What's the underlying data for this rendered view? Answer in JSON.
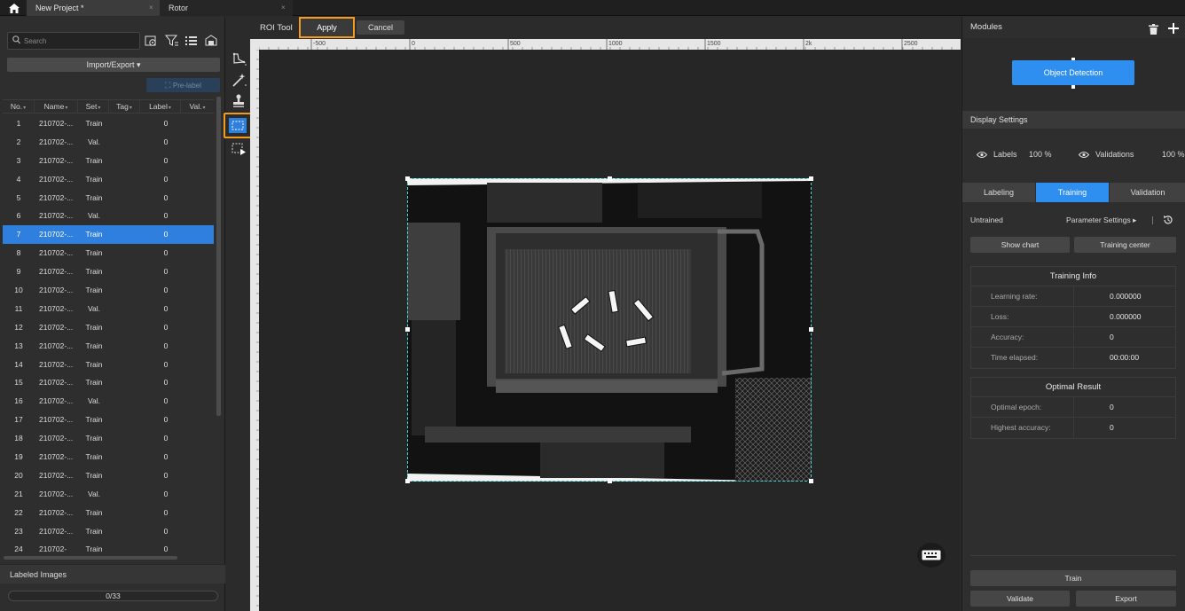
{
  "tabs": {
    "project": "New Project *",
    "rotor": "Rotor",
    "close_glyph": "×"
  },
  "left": {
    "search_placeholder": "Search",
    "import_export": "Import/Export ▾",
    "prelabel": "Pre-label",
    "columns": {
      "no": "No.",
      "name": "Name",
      "set": "Set",
      "tag": "Tag",
      "label": "Label",
      "val": "Val."
    },
    "rows": [
      {
        "no": "1",
        "name": "210702-...",
        "set": "Train",
        "label": "0"
      },
      {
        "no": "2",
        "name": "210702-...",
        "set": "Val.",
        "label": "0"
      },
      {
        "no": "3",
        "name": "210702-...",
        "set": "Train",
        "label": "0"
      },
      {
        "no": "4",
        "name": "210702-...",
        "set": "Train",
        "label": "0"
      },
      {
        "no": "5",
        "name": "210702-...",
        "set": "Train",
        "label": "0"
      },
      {
        "no": "6",
        "name": "210702-...",
        "set": "Val.",
        "label": "0"
      },
      {
        "no": "7",
        "name": "210702-...",
        "set": "Train",
        "label": "0",
        "selected": true
      },
      {
        "no": "8",
        "name": "210702-...",
        "set": "Train",
        "label": "0"
      },
      {
        "no": "9",
        "name": "210702-...",
        "set": "Train",
        "label": "0"
      },
      {
        "no": "10",
        "name": "210702-...",
        "set": "Train",
        "label": "0"
      },
      {
        "no": "11",
        "name": "210702-...",
        "set": "Val.",
        "label": "0"
      },
      {
        "no": "12",
        "name": "210702-...",
        "set": "Train",
        "label": "0"
      },
      {
        "no": "13",
        "name": "210702-...",
        "set": "Train",
        "label": "0"
      },
      {
        "no": "14",
        "name": "210702-...",
        "set": "Train",
        "label": "0"
      },
      {
        "no": "15",
        "name": "210702-...",
        "set": "Train",
        "label": "0"
      },
      {
        "no": "16",
        "name": "210702-...",
        "set": "Val.",
        "label": "0"
      },
      {
        "no": "17",
        "name": "210702-...",
        "set": "Train",
        "label": "0"
      },
      {
        "no": "18",
        "name": "210702-...",
        "set": "Train",
        "label": "0"
      },
      {
        "no": "19",
        "name": "210702-...",
        "set": "Train",
        "label": "0"
      },
      {
        "no": "20",
        "name": "210702-...",
        "set": "Train",
        "label": "0"
      },
      {
        "no": "21",
        "name": "210702-...",
        "set": "Val.",
        "label": "0"
      },
      {
        "no": "22",
        "name": "210702-...",
        "set": "Train",
        "label": "0"
      },
      {
        "no": "23",
        "name": "210702-...",
        "set": "Train",
        "label": "0"
      },
      {
        "no": "24",
        "name": "210702-",
        "set": "Train",
        "label": "0"
      }
    ],
    "labeled_images": "Labeled Images",
    "progress_text": "0/33",
    "progress_fraction": 0
  },
  "toolbar": {
    "roi_tool": "ROI Tool",
    "apply": "Apply",
    "cancel": "Cancel"
  },
  "ruler": {
    "top_marks": [
      "-500",
      "0",
      "500",
      "1000",
      "1500",
      "2k",
      "2500"
    ]
  },
  "right": {
    "modules": "Modules",
    "object_detection": "Object Detection",
    "display_settings": "Display Settings",
    "labels": "Labels",
    "labels_pct": "100 %",
    "validations": "Validations",
    "validations_pct": "100 %",
    "tab_labeling": "Labeling",
    "tab_training": "Training",
    "tab_validation": "Validation",
    "status": "Untrained",
    "param_settings": "Parameter Settings ▸",
    "show_chart": "Show chart",
    "training_center": "Training center",
    "training_info": {
      "title": "Training Info",
      "rows": [
        {
          "k": "Learning rate:",
          "v": "0.000000"
        },
        {
          "k": "Loss:",
          "v": "0.000000"
        },
        {
          "k": "Accuracy:",
          "v": "0"
        },
        {
          "k": "Time elapsed:",
          "v": "00:00:00"
        }
      ]
    },
    "optimal_result": {
      "title": "Optimal Result",
      "rows": [
        {
          "k": "Optimal epoch:",
          "v": "0"
        },
        {
          "k": "Highest accuracy:",
          "v": "0"
        }
      ]
    },
    "train": "Train",
    "validate": "Validate",
    "export": "Export"
  },
  "colors": {
    "accent": "#2f8ff0",
    "highlight": "#f29b1e",
    "roi": "#4ad3d3"
  }
}
